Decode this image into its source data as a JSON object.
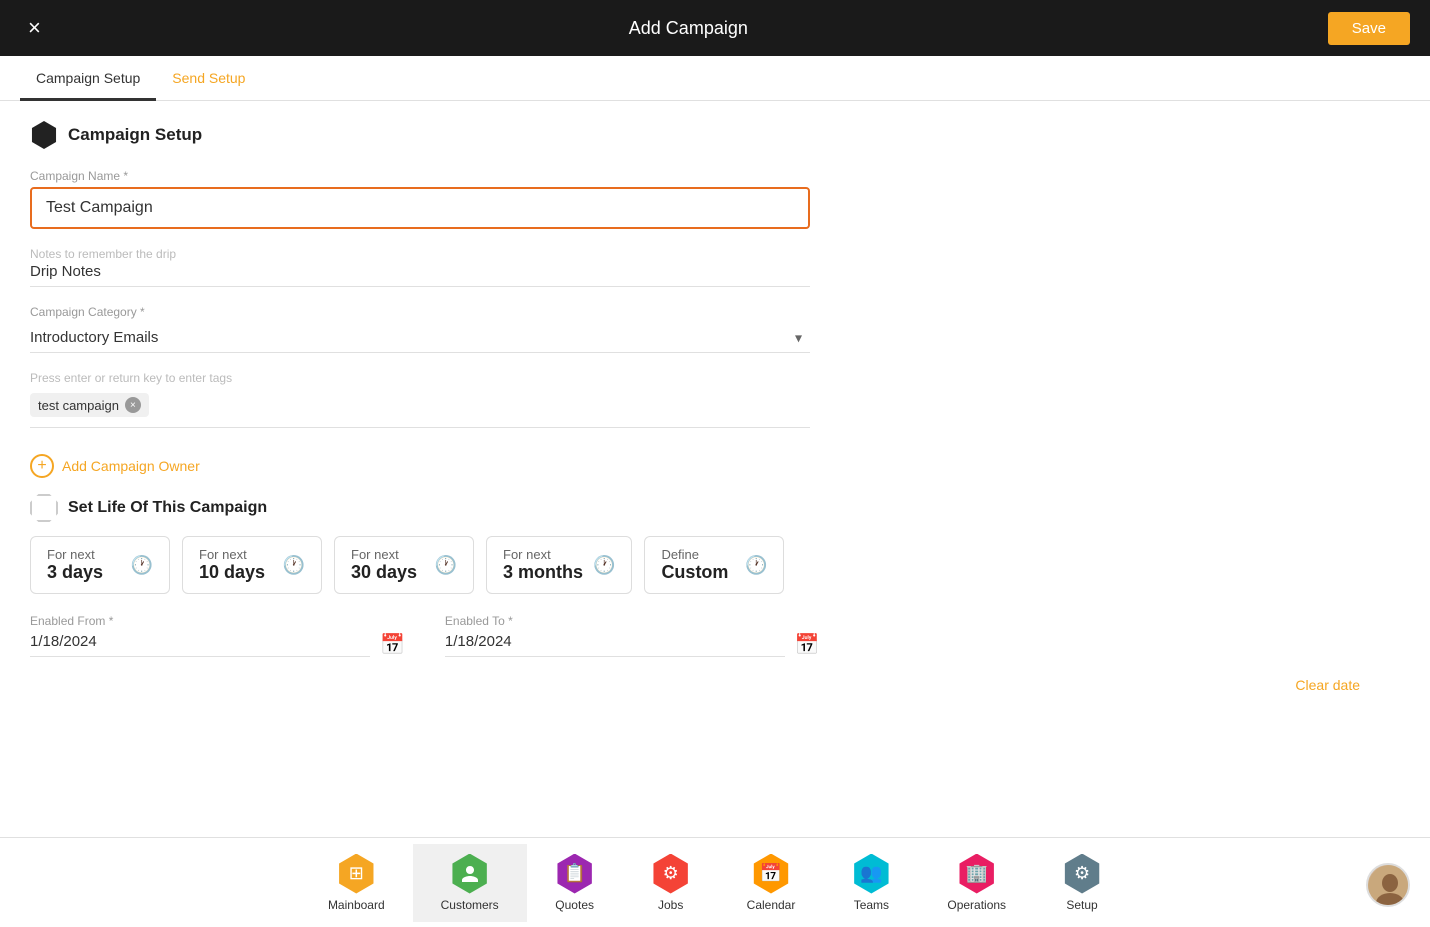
{
  "header": {
    "title": "Add Campaign",
    "close_label": "×",
    "save_label": "Save"
  },
  "tabs": [
    {
      "id": "campaign-setup",
      "label": "Campaign Setup",
      "active": true
    },
    {
      "id": "send-setup",
      "label": "Send Setup",
      "active": false
    }
  ],
  "form": {
    "section_title": "Campaign Setup",
    "campaign_name_label": "Campaign Name *",
    "campaign_name_value": "Test Campaign",
    "drip_notes_label": "Notes to remember the drip",
    "drip_notes_value": "Drip Notes",
    "category_label": "Campaign Category *",
    "category_value": "Introductory Emails",
    "tags_placeholder": "Press enter or return key to enter tags",
    "tags": [
      {
        "id": "tag1",
        "label": "test campaign"
      }
    ],
    "add_owner_label": "Add Campaign Owner",
    "life_section_title": "Set Life Of This Campaign",
    "life_options": [
      {
        "id": "3days",
        "line1": "For next",
        "line2": "3 days"
      },
      {
        "id": "10days",
        "line1": "For next",
        "line2": "10 days"
      },
      {
        "id": "30days",
        "line1": "For next",
        "line2": "30 days"
      },
      {
        "id": "3months",
        "line1": "For next",
        "line2": "3 months"
      },
      {
        "id": "custom",
        "line1": "Define",
        "line2": "Custom"
      }
    ],
    "enabled_from_label": "Enabled From *",
    "enabled_from_value": "1/18/2024",
    "enabled_to_label": "Enabled To *",
    "enabled_to_value": "1/18/2024",
    "clear_date_label": "Clear date"
  },
  "bottom_nav": {
    "items": [
      {
        "id": "mainboard",
        "label": "Mainboard",
        "color": "#f5a623",
        "icon": "⊞"
      },
      {
        "id": "customers",
        "label": "Customers",
        "color": "#4caf50",
        "icon": "👤",
        "active": true
      },
      {
        "id": "quotes",
        "label": "Quotes",
        "color": "#9c27b0",
        "icon": "📋"
      },
      {
        "id": "jobs",
        "label": "Jobs",
        "color": "#f44336",
        "icon": "⚙"
      },
      {
        "id": "calendar",
        "label": "Calendar",
        "color": "#ff9800",
        "icon": "📅"
      },
      {
        "id": "teams",
        "label": "Teams",
        "color": "#00bcd4",
        "icon": "👥"
      },
      {
        "id": "operations",
        "label": "Operations",
        "color": "#e91e63",
        "icon": "🏢"
      },
      {
        "id": "setup",
        "label": "Setup",
        "color": "#607d8b",
        "icon": "⚙"
      }
    ]
  }
}
